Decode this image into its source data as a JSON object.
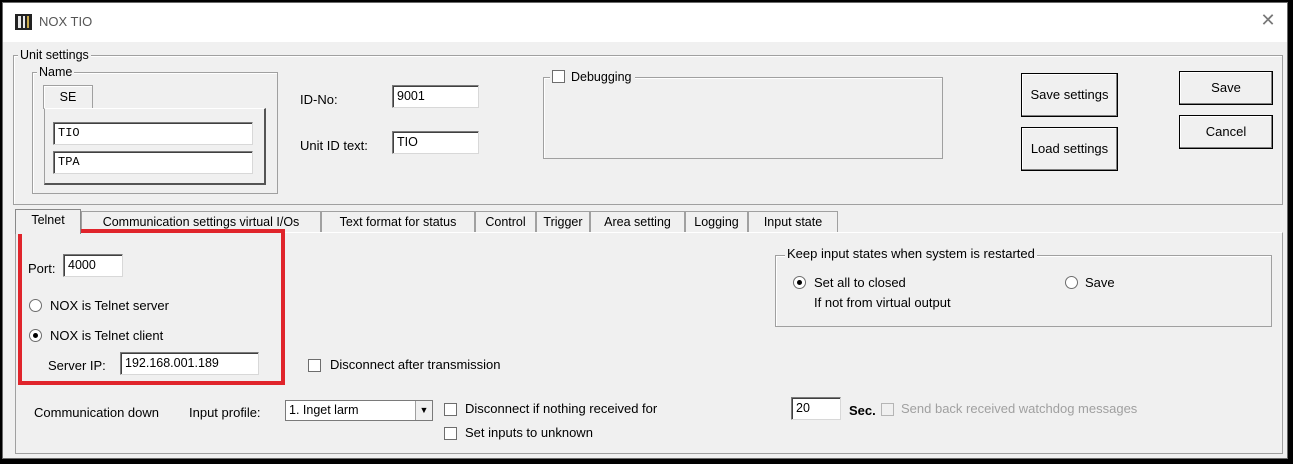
{
  "window": {
    "title": "NOX TIO",
    "close_glyph": "✕"
  },
  "unit_settings": {
    "legend": "Unit settings",
    "name_group": {
      "legend": "Name",
      "tab_label": "SE",
      "field1": "TIO",
      "field2": "TPA"
    },
    "id_no_label": "ID-No:",
    "id_no_value": "9001",
    "unit_id_text_label": "Unit ID text:",
    "unit_id_text_value": "TIO",
    "debugging_label": "Debugging",
    "debugging_checked": false,
    "save_settings_label": "Save settings",
    "load_settings_label": "Load settings",
    "save_label": "Save",
    "cancel_label": "Cancel"
  },
  "tabs": [
    {
      "label": "Telnet",
      "active": true
    },
    {
      "label": "Communication settings virtual I/Os"
    },
    {
      "label": "Text format for status"
    },
    {
      "label": "Control"
    },
    {
      "label": "Trigger"
    },
    {
      "label": "Area setting"
    },
    {
      "label": "Logging"
    },
    {
      "label": "Input state"
    }
  ],
  "telnet": {
    "port_label": "Port:",
    "port_value": "4000",
    "server_label": "NOX is Telnet server",
    "client_label": "NOX is Telnet client",
    "mode_selected": "client",
    "server_ip_label": "Server IP:",
    "server_ip_value": "192.168.001.189",
    "disconnect_after_label": "Disconnect after transmission",
    "keep_input": {
      "legend": "Keep input states when system is restarted",
      "set_closed_label": "Set all to closed",
      "not_from_label": "If not from virtual output",
      "save_label": "Save",
      "selected": "set_closed"
    },
    "comm_down_label": "Communication down",
    "input_profile_label": "Input profile:",
    "input_profile_value": "1. Inget larm",
    "disconnect_nothing_label": "Disconnect if nothing received for",
    "seconds_value": "20",
    "sec_label": "Sec.",
    "send_back_label": "Send back received watchdog messages",
    "set_inputs_label": "Set inputs to unknown"
  },
  "colors": {
    "highlight": "#e0242b",
    "window_bg": "#f0f0f0"
  },
  "icons": {
    "app": "nox-app-icon",
    "close": "close-icon",
    "dropdown": "chevron-down-icon"
  }
}
